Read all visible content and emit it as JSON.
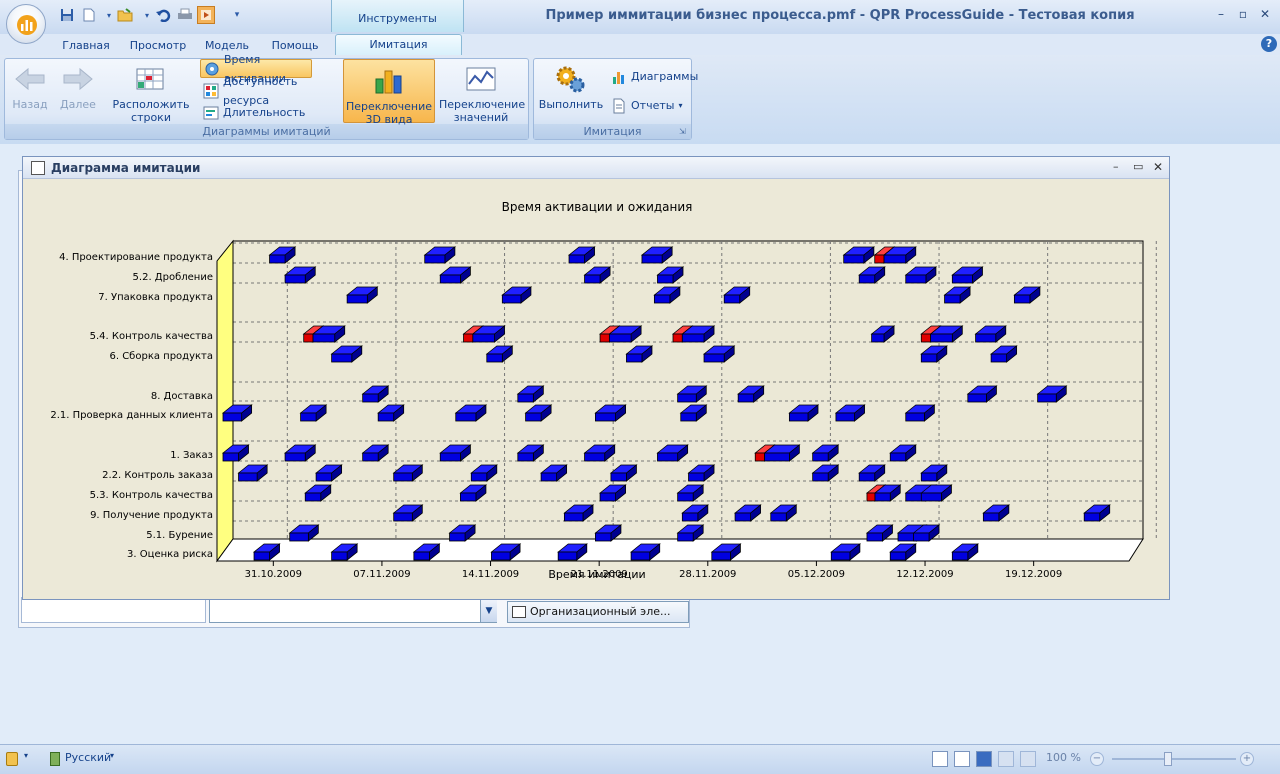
{
  "window": {
    "title": "Пример иммитации бизнес процесса.pmf - QPR ProcessGuide - Тестовая копия",
    "context_tab_group": "Инструменты имитации"
  },
  "tabs": [
    "Главная",
    "Просмотр",
    "Модель",
    "Помощь"
  ],
  "active_tab": "Имитация",
  "ribbon": {
    "group1": {
      "caption": "Диаграммы имитаций",
      "back": "Назад",
      "forward": "Далее",
      "arrange": "Расположить строки",
      "activation": "Время активации",
      "availability": "Доступность ресурса",
      "duration": "Длительность",
      "switch3d": "Переключение 3D вида",
      "switch_values": "Переключение значений"
    },
    "group2": {
      "caption": "Имитация",
      "run": "Выполнить",
      "diagrams": "Диаграммы",
      "reports": "Отчеты"
    }
  },
  "sim_window": {
    "title": "Диаграмма имитации"
  },
  "behind": {
    "dropdown_value": "Организационный эле..."
  },
  "status": {
    "language": "Русский",
    "zoom": "100 %"
  },
  "colors": {
    "bar": "#0000e0",
    "wait": "#e00000",
    "axis_fill": "#ffff80",
    "plot": "#ebe8d6"
  },
  "chart_data": {
    "type": "bar",
    "title": "Время активации и ожидания",
    "xlabel": "Время имитации",
    "ylabel": "",
    "categories": [
      "4. Проектирование продукта",
      "5.2. Дробление",
      "7. Упаковка продукта",
      "5.4. Контроль качества",
      "6. Сборка продукта",
      "8. Доставка",
      "2.1. Проверка данных клиента",
      "1. Заказ",
      "2.2. Контроль заказа",
      "5.3. Контроль качества",
      "9. Получение продукта",
      "5.1. Бурение",
      "3. Оценка риска"
    ],
    "xticks": [
      "31.10.2009",
      "07.11.2009",
      "14.11.2009",
      "21.11.2009",
      "28.11.2009",
      "05.12.2009",
      "12.12.2009",
      "19.12.2009"
    ],
    "xlim_days": [
      0,
      58
    ],
    "legend_note": "blue = activation, red = waiting",
    "grid": true,
    "series": [
      {
        "row": 0,
        "bars": [
          [
            3,
            1
          ],
          [
            13,
            1.3
          ],
          [
            22.3,
            1
          ],
          [
            27,
            1.3
          ],
          [
            40,
            1.3
          ],
          [
            42,
            2,
            1
          ]
        ]
      },
      {
        "row": 1,
        "bars": [
          [
            4,
            1.3
          ],
          [
            14,
            1.3
          ],
          [
            23.3,
            1
          ],
          [
            28,
            1
          ],
          [
            44,
            1.3
          ],
          [
            47,
            1.3
          ],
          [
            41,
            1
          ]
        ]
      },
      {
        "row": 2,
        "bars": [
          [
            8,
            1.3
          ],
          [
            18,
            1.2
          ],
          [
            27.8,
            1
          ],
          [
            32.3,
            1
          ],
          [
            46.5,
            1
          ],
          [
            51,
            1
          ]
        ]
      },
      {
        "row": 3,
        "bars": [
          [
            5.2,
            2,
            1
          ],
          [
            15.5,
            2,
            1
          ],
          [
            24.3,
            2,
            1
          ],
          [
            29,
            2,
            1
          ],
          [
            41.8,
            0.8
          ],
          [
            45,
            2,
            1
          ],
          [
            48.5,
            1.3
          ]
        ]
      },
      {
        "row": 4,
        "bars": [
          [
            7,
            1.3
          ],
          [
            17,
            1
          ],
          [
            26,
            1
          ],
          [
            31,
            1.3
          ],
          [
            45,
            1
          ],
          [
            49.5,
            1
          ]
        ]
      },
      {
        "row": 5,
        "bars": [
          [
            9,
            1
          ],
          [
            19,
            1
          ],
          [
            29.3,
            1.2
          ],
          [
            33.2,
            1
          ],
          [
            48,
            1.2
          ],
          [
            52.5,
            1.2
          ]
        ]
      },
      {
        "row": 6,
        "bars": [
          [
            0,
            1.2
          ],
          [
            5,
            1
          ],
          [
            10,
            1
          ],
          [
            15,
            1.3
          ],
          [
            19.5,
            1
          ],
          [
            24,
            1.3
          ],
          [
            29.5,
            1
          ],
          [
            36.5,
            1.2
          ],
          [
            39.5,
            1.2
          ],
          [
            44,
            1.2
          ]
        ]
      },
      {
        "row": 7,
        "bars": [
          [
            0,
            1
          ],
          [
            4,
            1.3
          ],
          [
            9,
            1
          ],
          [
            14,
            1.3
          ],
          [
            19,
            1
          ],
          [
            23.3,
            1.3
          ],
          [
            28,
            1.3
          ],
          [
            34.3,
            2.2,
            1
          ],
          [
            38,
            1
          ],
          [
            43,
            1
          ]
        ]
      },
      {
        "row": 8,
        "bars": [
          [
            1,
            1.2
          ],
          [
            6,
            1
          ],
          [
            11,
            1.2
          ],
          [
            16,
            1
          ],
          [
            20.5,
            1
          ],
          [
            25,
            1
          ],
          [
            30,
            1
          ],
          [
            38,
            1
          ],
          [
            41,
            1
          ],
          [
            45,
            1
          ]
        ]
      },
      {
        "row": 9,
        "bars": [
          [
            5.3,
            1
          ],
          [
            15.3,
            1
          ],
          [
            24.3,
            1
          ],
          [
            29.3,
            1
          ],
          [
            41.5,
            1.5,
            0.6
          ],
          [
            44,
            1.3
          ],
          [
            45,
            1.3
          ]
        ]
      },
      {
        "row": 10,
        "bars": [
          [
            11,
            1.2
          ],
          [
            22,
            1.2
          ],
          [
            29.6,
            1
          ],
          [
            33,
            1
          ],
          [
            35.3,
            1
          ],
          [
            49,
            1
          ],
          [
            55.5,
            1
          ]
        ]
      },
      {
        "row": 11,
        "bars": [
          [
            4.3,
            1.2
          ],
          [
            14.6,
            1
          ],
          [
            24,
            1
          ],
          [
            29.3,
            1
          ],
          [
            41.5,
            1
          ],
          [
            43.5,
            1.2
          ],
          [
            44.5,
            1
          ]
        ]
      },
      {
        "row": 12,
        "bars": [
          [
            2,
            1
          ],
          [
            7,
            1
          ],
          [
            12.3,
            1
          ],
          [
            17.3,
            1.2
          ],
          [
            21.6,
            1.2
          ],
          [
            26.3,
            1.2
          ],
          [
            31.5,
            1.2
          ],
          [
            39.2,
            1.2
          ],
          [
            43,
            1
          ],
          [
            47,
            1
          ]
        ]
      }
    ]
  }
}
